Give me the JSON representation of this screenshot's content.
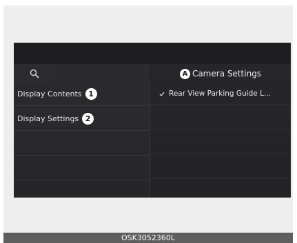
{
  "screen": {
    "header": {
      "marker": "A",
      "title": "Camera Settings"
    },
    "menu": [
      {
        "label": "Display Contents",
        "badge": "1"
      },
      {
        "label": "Display Settings",
        "badge": "2"
      }
    ],
    "options": [
      {
        "label": "Rear View Parking Guide L...",
        "checked": true
      }
    ],
    "icons": {
      "search": "search-icon",
      "checkbox": "checkbox-checked-icon"
    }
  },
  "caption": "OSK3052360L",
  "colors": {
    "screen_bg": "#232326",
    "text": "#e6e6e6",
    "marker_bg": "#ffffff",
    "caption_bg": "#5e5e5e"
  }
}
